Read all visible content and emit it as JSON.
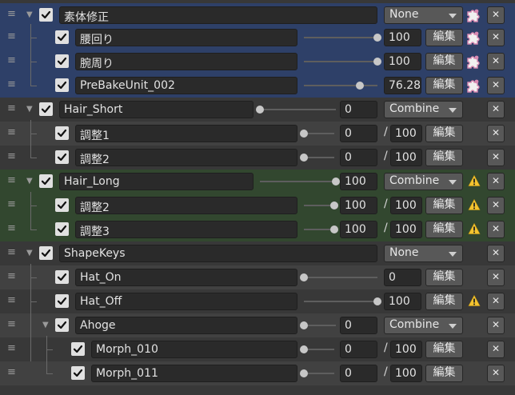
{
  "colors": {
    "selected_row": "#2e4068",
    "highlight_row": "#32472f",
    "warning": "#f4c430",
    "puzzle_icon": "#d98ab2"
  },
  "icons": {
    "drag": "drag-handle-icon",
    "fold": "expand-arrow-icon",
    "check": "checkbox-check-icon",
    "remove": "close-icon",
    "warning": "warning-icon",
    "extra": "puzzle-piece-icon"
  },
  "rows": [
    {
      "name": "素体修正",
      "mode": "None",
      "depth": 0,
      "fold": true,
      "puzzle": true
    },
    {
      "name": "腰回り",
      "value": "100",
      "slider": 1.0,
      "depth": 1,
      "edit": "編集",
      "puzzle": true
    },
    {
      "name": "腕周り",
      "value": "100",
      "slider": 1.0,
      "depth": 1,
      "edit": "編集",
      "puzzle": true
    },
    {
      "name": "PreBakeUnit_002",
      "value": "76.28",
      "slider": 0.7628,
      "depth": 1,
      "edit": "編集",
      "puzzle": true
    },
    {
      "name": "Hair_Short",
      "value": "0",
      "slider": 0.0,
      "mode": "Combine",
      "depth": 0,
      "fold": true
    },
    {
      "name": "調整1",
      "value": "0",
      "max": "100",
      "slider": 0.0,
      "depth": 1,
      "edit": "編集"
    },
    {
      "name": "調整2",
      "value": "0",
      "max": "100",
      "slider": 0.0,
      "depth": 1,
      "edit": "編集"
    },
    {
      "name": "Hair_Long",
      "value": "100",
      "slider": 1.0,
      "mode": "Combine",
      "depth": 0,
      "fold": true,
      "warn": true
    },
    {
      "name": "調整2",
      "value": "100",
      "max": "100",
      "slider": 1.0,
      "depth": 1,
      "edit": "編集",
      "warn": true
    },
    {
      "name": "調整3",
      "value": "100",
      "max": "100",
      "slider": 1.0,
      "depth": 1,
      "edit": "編集",
      "warn": true
    },
    {
      "name": "ShapeKeys",
      "mode": "None",
      "depth": 0,
      "fold": true
    },
    {
      "name": "Hat_On",
      "value": "0",
      "slider": 0.0,
      "depth": 1,
      "edit": "編集"
    },
    {
      "name": "Hat_Off",
      "value": "100",
      "slider": 1.0,
      "depth": 1,
      "edit": "編集",
      "warn": true
    },
    {
      "name": "Ahoge",
      "value": "0",
      "slider": 0.0,
      "mode": "Combine",
      "depth": 1,
      "fold": true
    },
    {
      "name": "Morph_010",
      "value": "0",
      "max": "100",
      "slider": 0.0,
      "depth": 2,
      "edit": "編集"
    },
    {
      "name": "Morph_011",
      "value": "0",
      "max": "100",
      "slider": 0.0,
      "depth": 2,
      "edit": "編集"
    }
  ]
}
